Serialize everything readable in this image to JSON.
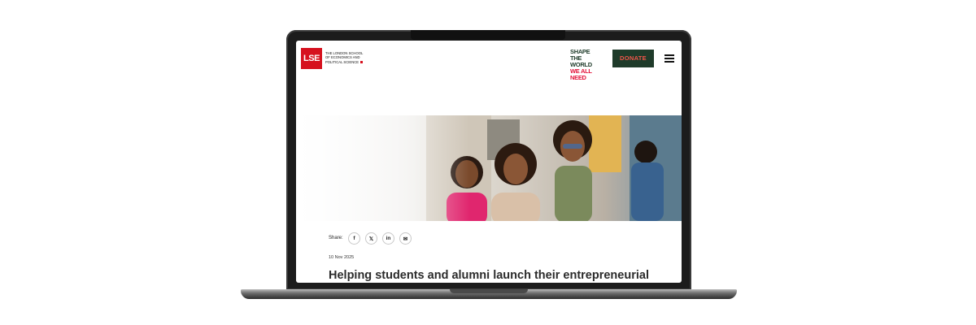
{
  "header": {
    "logo_text": "LSE",
    "school_name_lines": [
      "The London School",
      "of Economics and",
      "Political Science"
    ],
    "campaign_lines": [
      "SHAPE THE",
      "WORLD",
      "WE ALL NEED"
    ],
    "donate_label": "DONATE"
  },
  "article": {
    "share_label": "Share:",
    "share_icons": [
      "facebook-icon",
      "x-icon",
      "linkedin-icon",
      "email-icon"
    ],
    "share_glyphs": [
      "f",
      "𝕏",
      "in",
      "✉"
    ],
    "date": "10 Nov 2025",
    "headline": "Helping students and alumni launch their entrepreneurial"
  },
  "colors": {
    "brand_red": "#d6111e",
    "campaign_green": "#1f3b2a",
    "donate_text": "#f0564a",
    "campaign_accent": "#e3123a"
  }
}
